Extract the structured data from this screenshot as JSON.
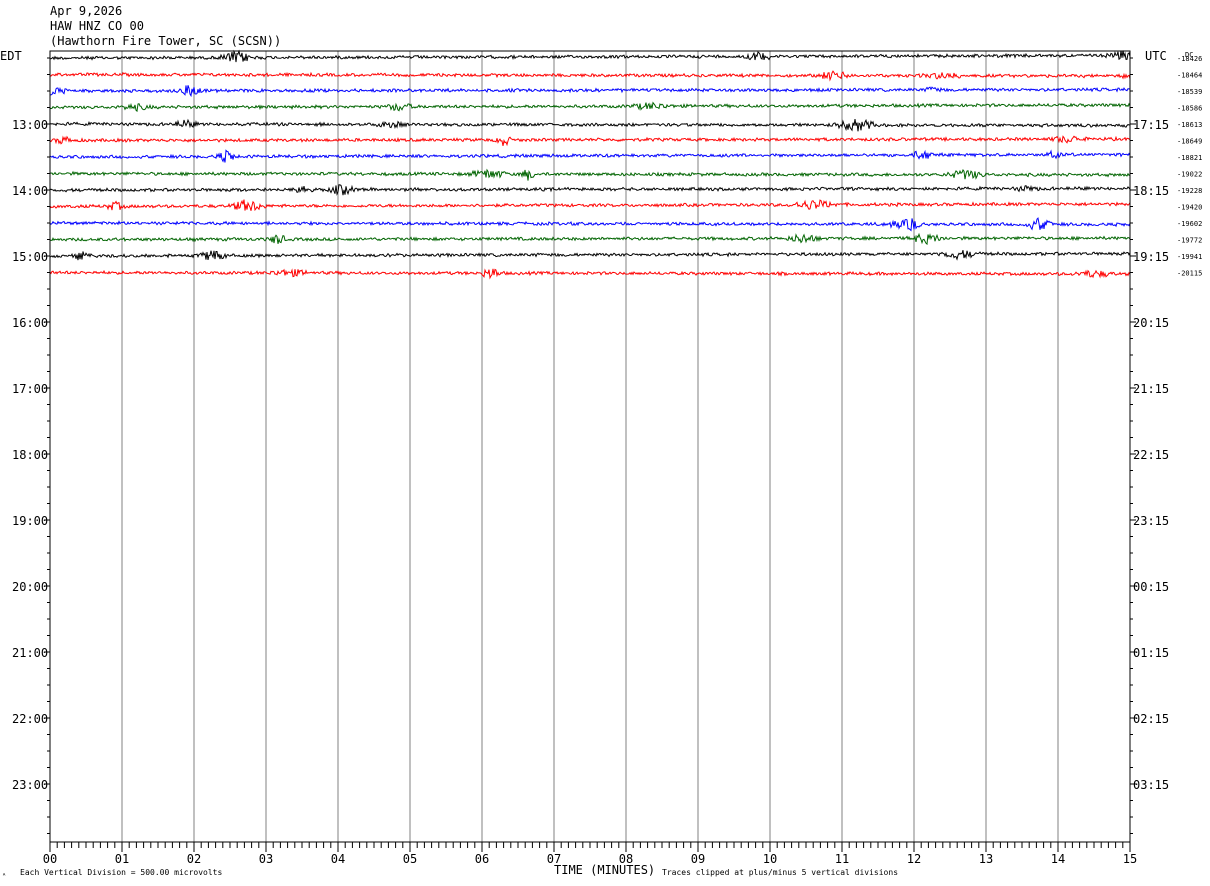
{
  "header": {
    "date": "Apr 9,2026",
    "station": "HAW HNZ CO 00",
    "location": "(Hawthorn Fire Tower, SC (SCSN))"
  },
  "footer": {
    "vertical_division": "Each Vertical Division =  500.00 microvolts",
    "clip_note": "Traces clipped at plus/minus 5 vertical divisions"
  },
  "chart_data": {
    "type": "line",
    "title": "",
    "xlabel": "TIME (MINUTES)",
    "ylabel": "",
    "xlim": [
      0,
      15
    ],
    "x_ticks": [
      "00",
      "01",
      "02",
      "03",
      "04",
      "05",
      "06",
      "07",
      "08",
      "09",
      "10",
      "11",
      "12",
      "13",
      "14",
      "15"
    ],
    "left_axis_title": "EDT",
    "right_axis_title": "UTC",
    "dc_label": "DC",
    "left_hour_labels": [
      "13:00",
      "14:00",
      "15:00",
      "16:00",
      "17:00",
      "18:00",
      "19:00",
      "20:00",
      "21:00",
      "22:00",
      "23:00"
    ],
    "right_hour_labels": [
      "17:15",
      "18:15",
      "19:15",
      "20:15",
      "21:15",
      "22:15",
      "23:15",
      "00:15",
      "01:15",
      "02:15",
      "03:15"
    ],
    "grid": true,
    "trace_colors": [
      "#000000",
      "#ff0000",
      "#0000ff",
      "#006400"
    ],
    "traces": [
      {
        "dc": "-18426",
        "color": "#000000"
      },
      {
        "dc": "-18464",
        "color": "#ff0000"
      },
      {
        "dc": "-18539",
        "color": "#0000ff"
      },
      {
        "dc": "-18586",
        "color": "#006400"
      },
      {
        "dc": "-18613",
        "color": "#000000"
      },
      {
        "dc": "-18649",
        "color": "#ff0000"
      },
      {
        "dc": "-18821",
        "color": "#0000ff"
      },
      {
        "dc": "-19022",
        "color": "#006400"
      },
      {
        "dc": "-19228",
        "color": "#000000"
      },
      {
        "dc": "-19420",
        "color": "#ff0000"
      },
      {
        "dc": "-19602",
        "color": "#0000ff"
      },
      {
        "dc": "-19772",
        "color": "#006400"
      },
      {
        "dc": "-19941",
        "color": "#000000"
      },
      {
        "dc": "-20115",
        "color": "#ff0000"
      }
    ]
  }
}
